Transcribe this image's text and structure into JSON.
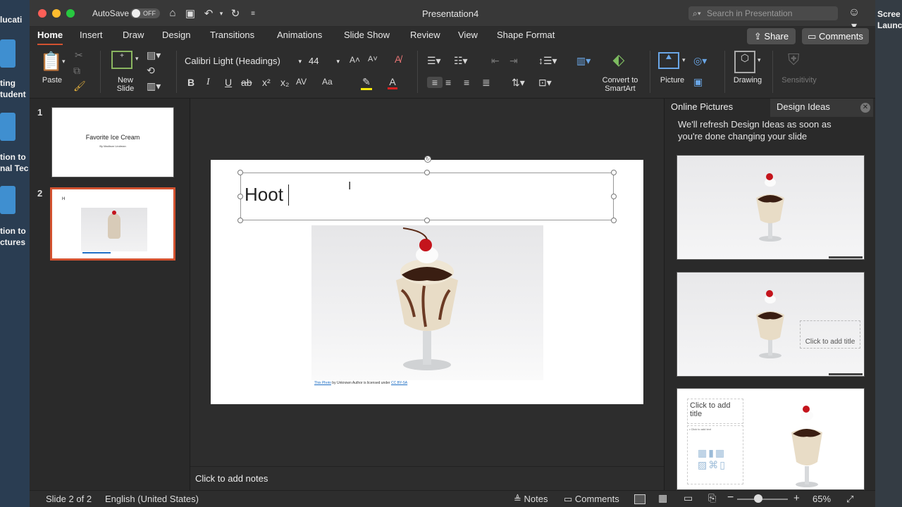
{
  "desktop": {
    "left_texts": [
      "lucati",
      "ting\ntudent",
      "tion to\nnal Tec",
      "tion to\nctures"
    ],
    "right_texts": [
      "Scree\nLaunc"
    ]
  },
  "titlebar": {
    "autosave_label": "AutoSave",
    "autosave_state": "OFF",
    "title": "Presentation4",
    "search_placeholder": "Search in Presentation"
  },
  "tabs": [
    "Home",
    "Insert",
    "Draw",
    "Design",
    "Transitions",
    "Animations",
    "Slide Show",
    "Review",
    "View",
    "Shape Format"
  ],
  "active_tab": "Home",
  "share_label": "Share",
  "comments_label": "Comments",
  "ribbon": {
    "paste_label": "Paste",
    "new_slide_label": "New\nSlide",
    "font_name": "Calibri Light (Headings)",
    "font_size": "44",
    "font_grow": "A˄",
    "font_shrink": "A˅",
    "bold": "B",
    "italic": "I",
    "underline": "U",
    "strike": "ab",
    "superscript": "x²",
    "subscript": "x₂",
    "char_spacing": "AV",
    "change_case": "Aa",
    "highlight_color": "#f4e80c",
    "font_color": "#d92121",
    "convert_smartart_label": "Convert to\nSmartArt",
    "picture_label": "Picture",
    "drawing_label": "Drawing",
    "sensitivity_label": "Sensitivity"
  },
  "slides": [
    {
      "number": "1",
      "title": "Favorite Ice Cream",
      "subtitle": "By Madison Lindman"
    },
    {
      "number": "2",
      "title": "H"
    }
  ],
  "current_slide": {
    "title_text": "Hoot ",
    "caption": {
      "link1": "This Photo",
      "middle": " by Unknown Author is licensed under ",
      "link2": "CC BY-SA"
    }
  },
  "notes_placeholder": "Click to add notes",
  "right_pane": {
    "tab_online": "Online Pictures",
    "tab_design": "Design Ideas",
    "message": "We'll refresh Design Ideas as soon as you're done changing your slide",
    "card2_title": "Click to add title",
    "card3_title": "Click to add\ntitle",
    "card3_text": "• Click to add text"
  },
  "status": {
    "slide_info": "Slide 2 of 2",
    "language": "English (United States)",
    "notes_label": "Notes",
    "comments_label": "Comments",
    "zoom": "65%",
    "zoom_level": 0.65
  },
  "colors": {
    "accent": "#d35230",
    "link": "#1f6fc4"
  }
}
